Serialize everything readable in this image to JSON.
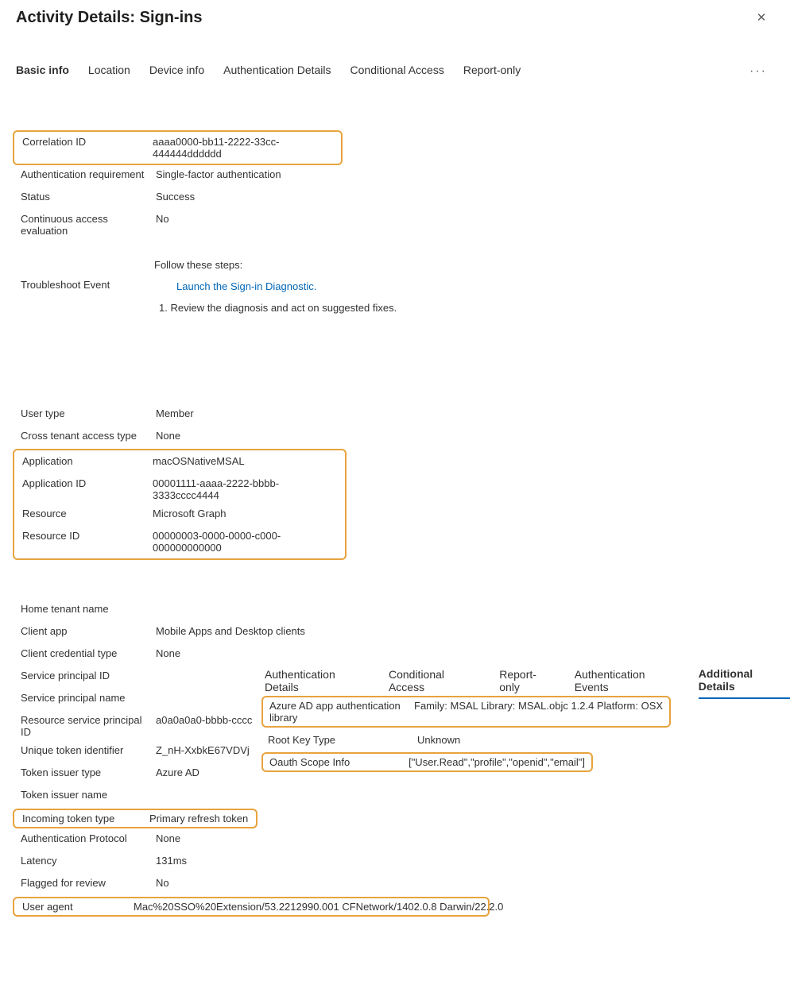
{
  "header": {
    "title": "Activity Details: Sign-ins"
  },
  "tabs": [
    {
      "label": "Basic info"
    },
    {
      "label": "Location"
    },
    {
      "label": "Device info"
    },
    {
      "label": "Authentication Details"
    },
    {
      "label": "Conditional Access"
    },
    {
      "label": "Report-only"
    }
  ],
  "section1": {
    "correlation_id_label": "Correlation ID",
    "correlation_id_value": "aaaa0000-bb11-2222-33cc-444444dddddd",
    "auth_req_label": "Authentication requirement",
    "auth_req_value": "Single-factor authentication",
    "status_label": "Status",
    "status_value": "Success",
    "cae_label": "Continuous access evaluation",
    "cae_value": "No",
    "troubleshoot_label": "Troubleshoot Event",
    "troubleshoot_heading": "Follow these steps:",
    "troubleshoot_link": "Launch the Sign-in Diagnostic.",
    "troubleshoot_step": "1. Review the diagnosis and act on suggested fixes."
  },
  "section2": {
    "user_type_label": "User type",
    "user_type_value": "Member",
    "cross_tenant_label": "Cross tenant access type",
    "cross_tenant_value": "None",
    "application_label": "Application",
    "application_value": "macOSNativeMSAL",
    "application_id_label": "Application ID",
    "application_id_value": "00001111-aaaa-2222-bbbb-3333cccc4444",
    "resource_label": "Resource",
    "resource_value": "Microsoft Graph",
    "resource_id_label": "Resource ID",
    "resource_id_value": "00000003-0000-0000-c000-000000000000"
  },
  "section3": {
    "home_tenant_label": "Home tenant name",
    "home_tenant_value": "",
    "client_app_label": "Client app",
    "client_app_value": "Mobile Apps and Desktop clients",
    "client_cred_label": "Client credential type",
    "client_cred_value": "None",
    "sp_id_label": "Service principal ID",
    "sp_id_value": "",
    "sp_name_label": "Service principal name",
    "sp_name_value": "",
    "rsp_id_label": "Resource service principal ID",
    "rsp_id_value": "a0a0a0a0-bbbb-cccc",
    "uti_label": "Unique token identifier",
    "uti_value": "Z_nH-XxbkE67VDVj",
    "token_issuer_type_label": "Token issuer type",
    "token_issuer_type_value": "Azure AD",
    "token_issuer_name_label": "Token issuer name",
    "token_issuer_name_value": "",
    "incoming_token_label": "Incoming token type",
    "incoming_token_value": "Primary refresh token",
    "auth_proto_label": "Authentication Protocol",
    "auth_proto_value": "None",
    "latency_label": "Latency",
    "latency_value": "131ms",
    "flagged_label": "Flagged for review",
    "flagged_value": "No",
    "user_agent_label": "User agent",
    "user_agent_value": "Mac%20SSO%20Extension/53.2212990.001 CFNetwork/1402.0.8 Darwin/22.2.0"
  },
  "subtabs": [
    {
      "label": "Authentication Details"
    },
    {
      "label": "Conditional Access"
    },
    {
      "label": "Report-only"
    },
    {
      "label": "Authentication Events"
    },
    {
      "label": "Additional Details"
    }
  ],
  "subdetails": {
    "lib_label": "Azure AD app authentication library",
    "lib_value": "Family: MSAL Library: MSAL.objc 1.2.4 Platform: OSX",
    "root_key_label": "Root Key Type",
    "root_key_value": "Unknown",
    "oauth_label": "Oauth Scope Info",
    "oauth_value": "[\"User.Read\",\"profile\",\"openid\",\"email\"]"
  }
}
